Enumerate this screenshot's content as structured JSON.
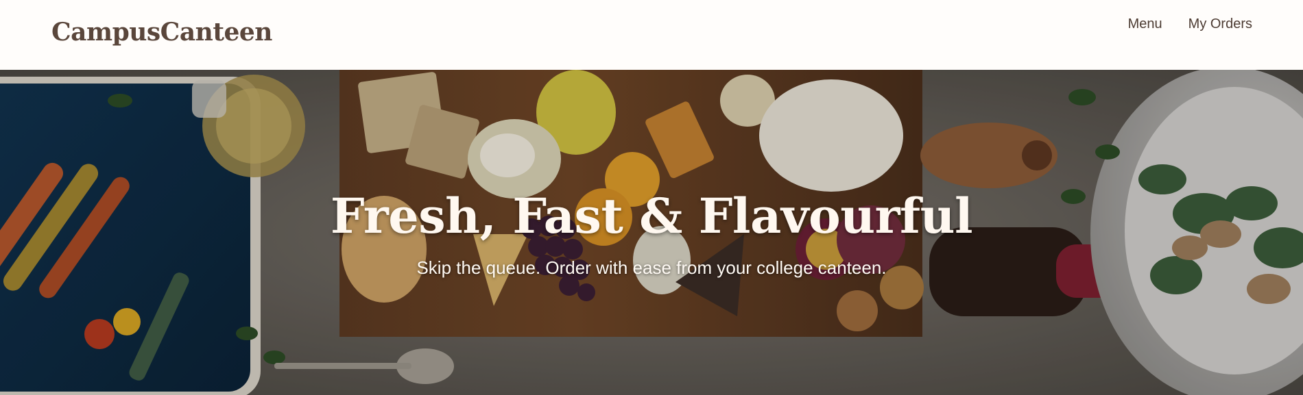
{
  "header": {
    "brand": "CampusCanteen",
    "nav": [
      {
        "label": "Menu",
        "icon": "none"
      },
      {
        "label": "My Orders",
        "icon": "none"
      }
    ]
  },
  "hero": {
    "title": "Fresh, Fast & Flavourful",
    "subtitle": "Skip the queue. Order with ease from your college canteen."
  },
  "colors": {
    "header_background": "#fffdfb",
    "brand_text": "#5a463b",
    "nav_text": "#4c3b32",
    "hero_text": "#fff8f0"
  }
}
